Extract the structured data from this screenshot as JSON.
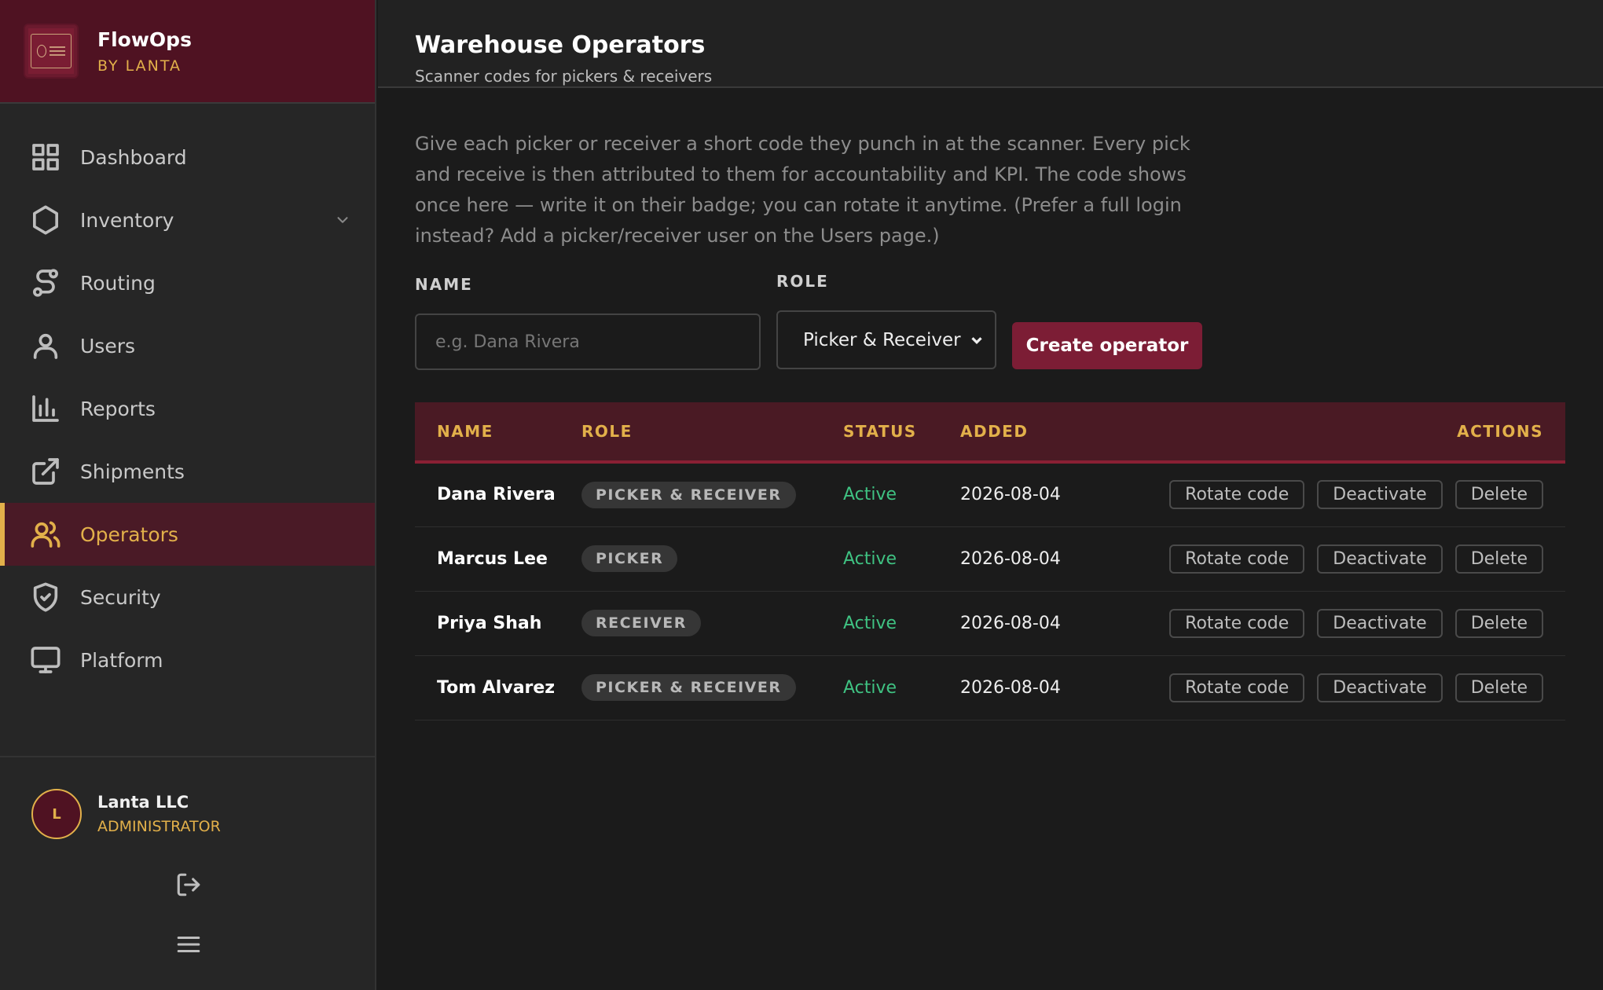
{
  "brand": {
    "name": "FlowOps",
    "sub": "BY LANTA"
  },
  "nav": [
    {
      "label": "Dashboard",
      "icon": "grid-icon"
    },
    {
      "label": "Inventory",
      "icon": "hexagon-icon"
    },
    {
      "label": "Routing",
      "icon": "route-icon"
    },
    {
      "label": "Users",
      "icon": "user-icon"
    },
    {
      "label": "Reports",
      "icon": "bar-chart-icon"
    },
    {
      "label": "Shipments",
      "icon": "external-link-icon"
    },
    {
      "label": "Operators",
      "icon": "users-icon",
      "active": true
    },
    {
      "label": "Security",
      "icon": "shield-icon"
    },
    {
      "label": "Platform",
      "icon": "monitor-icon"
    }
  ],
  "user": {
    "initial": "L",
    "name": "Lanta LLC",
    "role": "ADMINISTRATOR"
  },
  "header": {
    "title": "Warehouse Operators",
    "subtitle": "Scanner codes for pickers & receivers"
  },
  "description": "Give each picker or receiver a short code they punch in at the scanner. Every pick and receive is then attributed to them for accountability and KPI. The code shows once here — write it on their badge; you can rotate it anytime. (Prefer a full login instead? Add a picker/receiver user on the Users page.)",
  "form": {
    "name_label": "NAME",
    "name_placeholder": "e.g. Dana Rivera",
    "role_label": "ROLE",
    "role_value": "Picker & Receiver",
    "create_label": "Create operator"
  },
  "table": {
    "headers": {
      "name": "NAME",
      "role": "ROLE",
      "status": "STATUS",
      "added": "ADDED",
      "actions": "ACTIONS"
    },
    "action_labels": {
      "rotate": "Rotate code",
      "deactivate": "Deactivate",
      "delete": "Delete"
    },
    "rows": [
      {
        "name": "Dana Rivera",
        "role": "PICKER & RECEIVER",
        "status": "Active",
        "added": "2026-08-04"
      },
      {
        "name": "Marcus Lee",
        "role": "PICKER",
        "status": "Active",
        "added": "2026-08-04"
      },
      {
        "name": "Priya Shah",
        "role": "RECEIVER",
        "status": "Active",
        "added": "2026-08-04"
      },
      {
        "name": "Tom Alvarez",
        "role": "PICKER & RECEIVER",
        "status": "Active",
        "added": "2026-08-04"
      }
    ]
  },
  "colors": {
    "accent": "#e2b04a",
    "brand": "#4f1222",
    "primary_button": "#7c1d35",
    "active_status": "#3fc282"
  }
}
